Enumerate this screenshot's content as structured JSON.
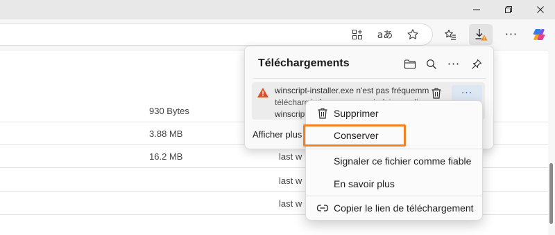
{
  "window": {
    "controls": [
      {
        "name": "minimize",
        "icon": "minimize-icon"
      },
      {
        "name": "maximize",
        "icon": "restore-icon"
      },
      {
        "name": "close",
        "icon": "close-icon"
      }
    ]
  },
  "toolbar": {
    "icons": [
      "apps-icon",
      "read-aloud-icon",
      "favorite-star-icon",
      "favorites-list-icon",
      "downloads-warning-icon",
      "more-icon",
      "copilot-icon"
    ],
    "read_aloud_glyph": "aあ",
    "more_glyph": "···"
  },
  "page": {
    "rows": [
      {
        "size": "930 Bytes",
        "modified": ""
      },
      {
        "size": "3.88 MB",
        "modified": ""
      },
      {
        "size": "16.2 MB",
        "modified": "last w"
      },
      {
        "size": "",
        "modified": "last w"
      },
      {
        "size": "",
        "modified": "last w"
      }
    ]
  },
  "downloads": {
    "title": "Téléchargements",
    "header_icons": [
      "folder-icon",
      "search-icon",
      "more-icon",
      "pin-icon"
    ],
    "more_glyph": "···",
    "item": {
      "line1": "winscript-installer.exe n'est pas fréquemment",
      "line2": "téléchargé. Assurez-vous de faire confiance à",
      "line3": "winscript-installer.exe avant de l'ouvrir.",
      "more_glyph": "···"
    },
    "show_more": "Afficher plus"
  },
  "context_menu": {
    "items": [
      {
        "label": "Supprimer",
        "icon": "trash-icon"
      },
      {
        "label": "Conserver",
        "icon": ""
      },
      {
        "label": "Signaler ce fichier comme fiable",
        "icon": ""
      },
      {
        "label": "En savoir plus",
        "icon": ""
      },
      {
        "label": "Copier le lien de téléchargement",
        "icon": "link-icon"
      }
    ],
    "highlighted_item": "Conserver"
  },
  "colors": {
    "highlight_border": "#f08222",
    "warning": "#d9502b",
    "accent_blue": "#2b5fb3",
    "titlebar_bg": "#e8e8e8"
  }
}
